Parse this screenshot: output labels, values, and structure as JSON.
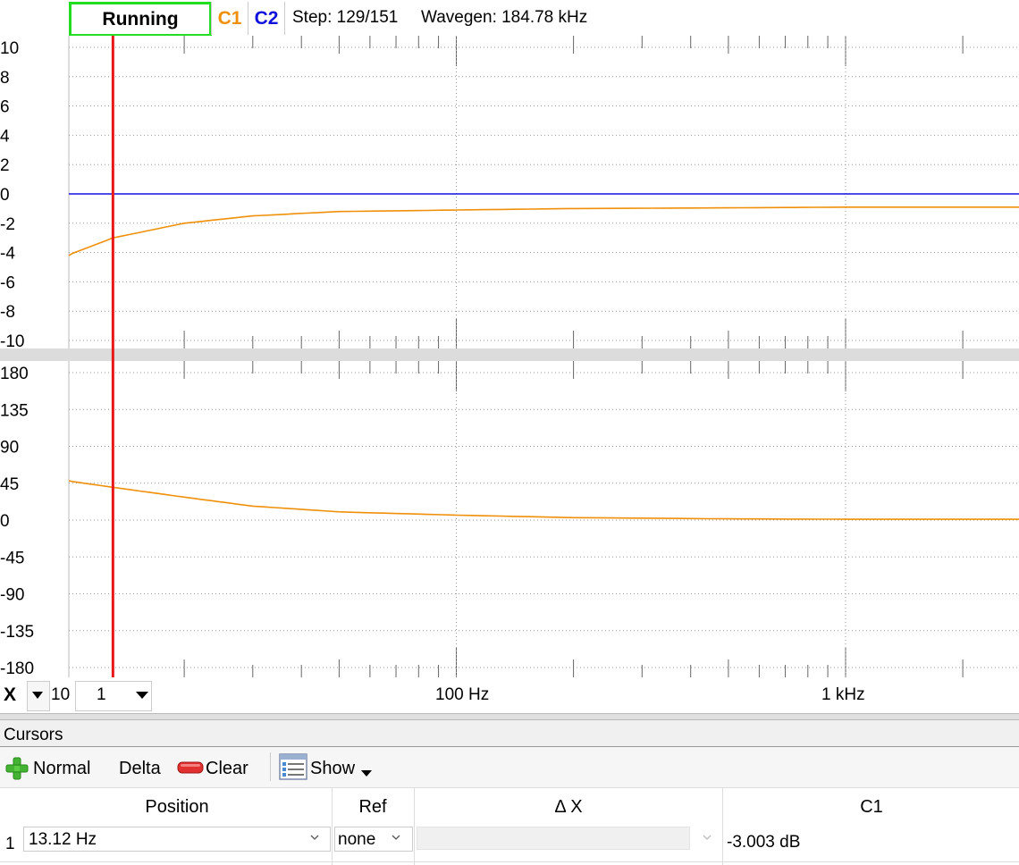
{
  "topbar": {
    "run_label": "Running",
    "c1_label": "C1",
    "c2_label": "C2",
    "step_text": "Step: 129/151",
    "wavegen_text": "Wavegen: 184.78 kHz"
  },
  "colors": {
    "c1": "#f0900a",
    "c2": "#1010dd",
    "cursor": "#e81818",
    "run_border": "#22dd22"
  },
  "magnitude_plot": {
    "y_ticks": [
      "10",
      "8",
      "6",
      "4",
      "2",
      "0",
      "-2",
      "-4",
      "-6",
      "-8",
      "-10"
    ]
  },
  "phase_plot": {
    "y_ticks": [
      "180",
      "135",
      "90",
      "45",
      "0",
      "-45",
      "-90",
      "-135",
      "-180"
    ]
  },
  "x_axis": {
    "label": "X",
    "decade_label": "10",
    "decade_value": "1",
    "tick_labels": [
      "100 Hz",
      "1 kHz"
    ]
  },
  "chart_data": [
    {
      "type": "line",
      "x_scale": "log",
      "xlim": [
        10,
        4440
      ],
      "ylim": [
        -10,
        10
      ],
      "series": [
        {
          "name": "C1",
          "color": "#f0900a",
          "x": [
            10,
            13.12,
            20,
            30,
            50,
            100,
            200,
            500,
            1000,
            4440
          ],
          "y": [
            -4.2,
            -3.003,
            -2.0,
            -1.5,
            -1.2,
            -1.1,
            -1.0,
            -0.95,
            -0.9,
            -0.9
          ]
        },
        {
          "name": "C2",
          "color": "#1010dd",
          "x": [
            10,
            4440
          ],
          "y": [
            0,
            0
          ]
        }
      ]
    },
    {
      "type": "line",
      "x_scale": "log",
      "xlim": [
        10,
        4440
      ],
      "ylim": [
        -180,
        180
      ],
      "series": [
        {
          "name": "C1",
          "color": "#f0900a",
          "x": [
            10,
            13.12,
            20,
            30,
            50,
            100,
            200,
            500,
            1000,
            4440
          ],
          "y": [
            48,
            40,
            28,
            17,
            10,
            6,
            3,
            1.5,
            1,
            1
          ]
        }
      ]
    }
  ],
  "cursor": {
    "x": 13.12
  },
  "cursors_panel": {
    "title": "Cursors",
    "normal_label": "Normal",
    "delta_label": "Delta",
    "clear_label": "Clear",
    "show_label": "Show",
    "columns": [
      "Position",
      "Ref",
      "Δ X",
      "C1"
    ],
    "rows": [
      {
        "index": "1",
        "position": "13.12 Hz",
        "ref": "none",
        "delta_x": "",
        "c1": "-3.003 dB"
      }
    ]
  }
}
